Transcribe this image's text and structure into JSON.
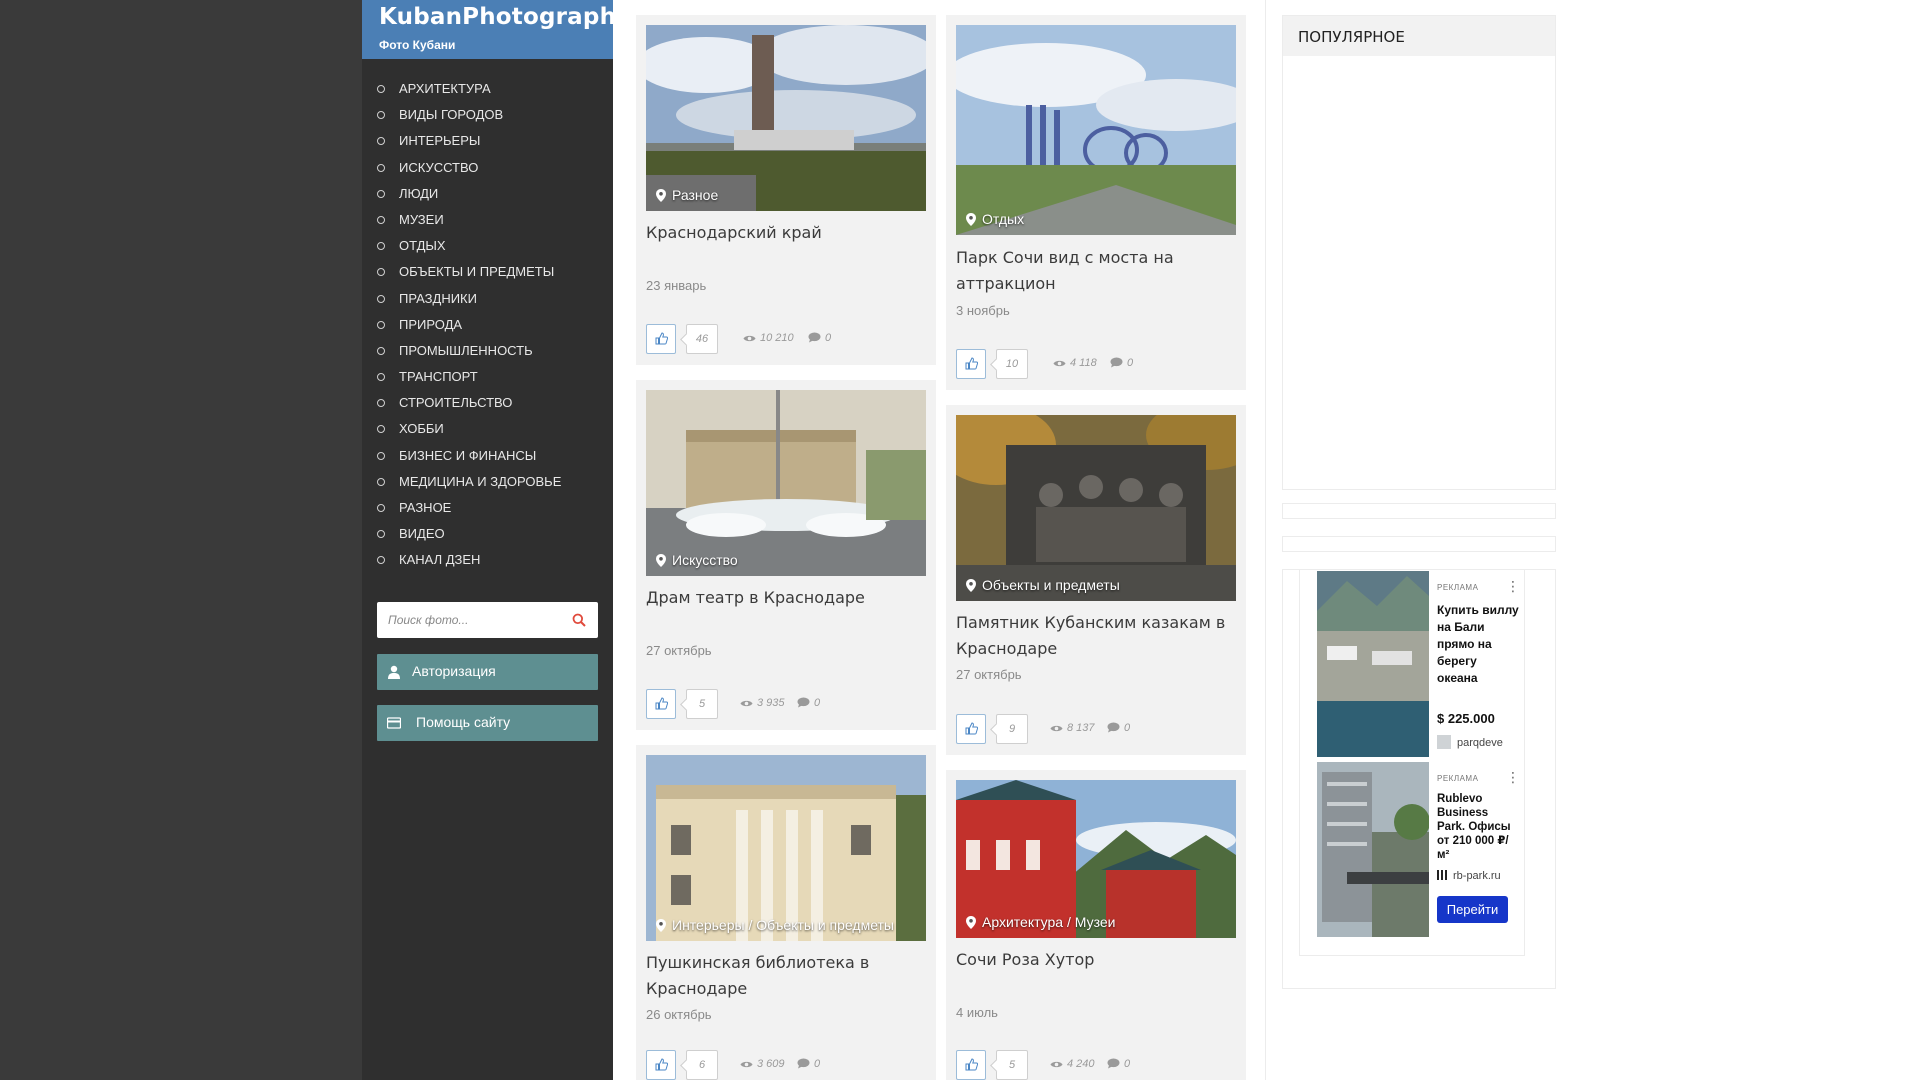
{
  "site": {
    "title": "KubanPhotography",
    "subtitle": "Фото Кубани"
  },
  "menu": [
    "АРХИТЕКТУРА",
    "ВИДЫ ГОРОДОВ",
    "ИНТЕРЬЕРЫ",
    "ИСКУССТВО",
    "ЛЮДИ",
    "МУЗЕИ",
    "ОТДЫХ",
    "ОБЪЕКТЫ И ПРЕДМЕТЫ",
    "ПРАЗДНИКИ",
    "ПРИРОДА",
    "ПРОМЫШЛЕННОСТЬ",
    "ТРАНСПОРТ",
    "СТРОИТЕЛЬСТВО",
    "ХОББИ",
    "БИЗНЕС И ФИНАНСЫ",
    "МЕДИЦИНА И ЗДОРОВЬЕ",
    "РАЗНОЕ",
    "ВИДЕО",
    "КАНАЛ ДЗЕН"
  ],
  "search": {
    "placeholder": "Поиск фото..."
  },
  "buttons": {
    "auth": "Авторизация",
    "help": "Помощь сайту"
  },
  "posts": [
    {
      "category": "Разное",
      "title": "Краснодарский край",
      "date": "23 январь",
      "likes": "46",
      "views": "10 210",
      "comments": "0"
    },
    {
      "category": "Искусство",
      "title": "Драм театр в Краснодаре",
      "date": "27 октябрь",
      "likes": "5",
      "views": "3 935",
      "comments": "0"
    },
    {
      "category": "Интерьеры / Объекты и предметы",
      "title": "Пушкинская библиотека в Краснодаре",
      "date": "26 октябрь",
      "likes": "6",
      "views": "3 609",
      "comments": "0"
    },
    {
      "category": "Отдых",
      "title": "Парк Сочи вид с моста на аттракцион",
      "date": "3 ноябрь",
      "likes": "10",
      "views": "4 118",
      "comments": "0"
    },
    {
      "category": "Объекты и предметы",
      "title": "Памятник Кубанским казакам в Краснодаре",
      "date": "27 октябрь",
      "likes": "9",
      "views": "8 137",
      "comments": "0"
    },
    {
      "category": "Архитектура / Музеи",
      "title": "Сочи Роза Хутор",
      "date": "4 июль",
      "likes": "5",
      "views": "4 240",
      "comments": "0"
    }
  ],
  "popular": {
    "title": "ПОПУЛЯРНОЕ"
  },
  "ads": [
    {
      "badge": "РЕКЛАМА",
      "text": "Купить виллу на Бали прямо на берегу океана",
      "price": "$ 225.000",
      "domain": "parqdeve"
    },
    {
      "badge": "РЕКЛАМА",
      "text": "Rublevo Business Park. Офисы от 210 000 ₽/м²",
      "domain": "rb-park.ru",
      "cta": "Перейти"
    }
  ],
  "colors": {
    "logo_bg": "#4b7fb5",
    "sidebar_bg": "#2f2f2f",
    "button_bg": "#5e8f91",
    "ad_cta": "#1636c9"
  }
}
